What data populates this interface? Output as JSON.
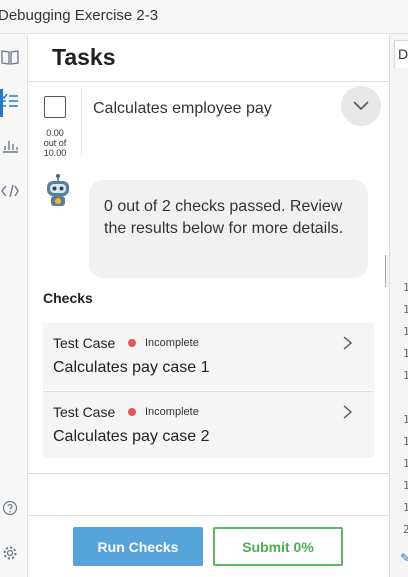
{
  "window": {
    "title": "Debugging Exercise 2-3"
  },
  "sidebar": {
    "icons": [
      "book-icon",
      "tasks-list-icon",
      "bar-chart-icon",
      "code-icon",
      "help-icon",
      "settings-gear-icon"
    ],
    "active_icon": "tasks-list-icon",
    "accent_color": "#2b78c2"
  },
  "panel": {
    "title": "Tasks",
    "task": {
      "name": "Calculates employee pay",
      "score_line1": "0.00",
      "score_line2": "out of",
      "score_line3": "10.00",
      "checked": false
    },
    "feedback": {
      "message": "0 out of 2 checks passed. Review the results below for more details."
    },
    "checks_label": "Checks",
    "checks": [
      {
        "type": "Test Case",
        "status": "Incomplete",
        "name": "Calculates pay case 1"
      },
      {
        "type": "Test Case",
        "status": "Incomplete",
        "name": "Calculates pay case 2"
      }
    ],
    "status_color": "#e05757"
  },
  "footer": {
    "run_label": "Run Checks",
    "submit_label": "Submit 0%",
    "run_color": "#56a3d9",
    "submit_color": "#4caf50"
  },
  "editor": {
    "tab_label": "D",
    "line_numbers": [
      "1",
      "1",
      "1",
      "1",
      "1",
      "1",
      "1",
      "1",
      "1",
      "1",
      "2"
    ]
  }
}
